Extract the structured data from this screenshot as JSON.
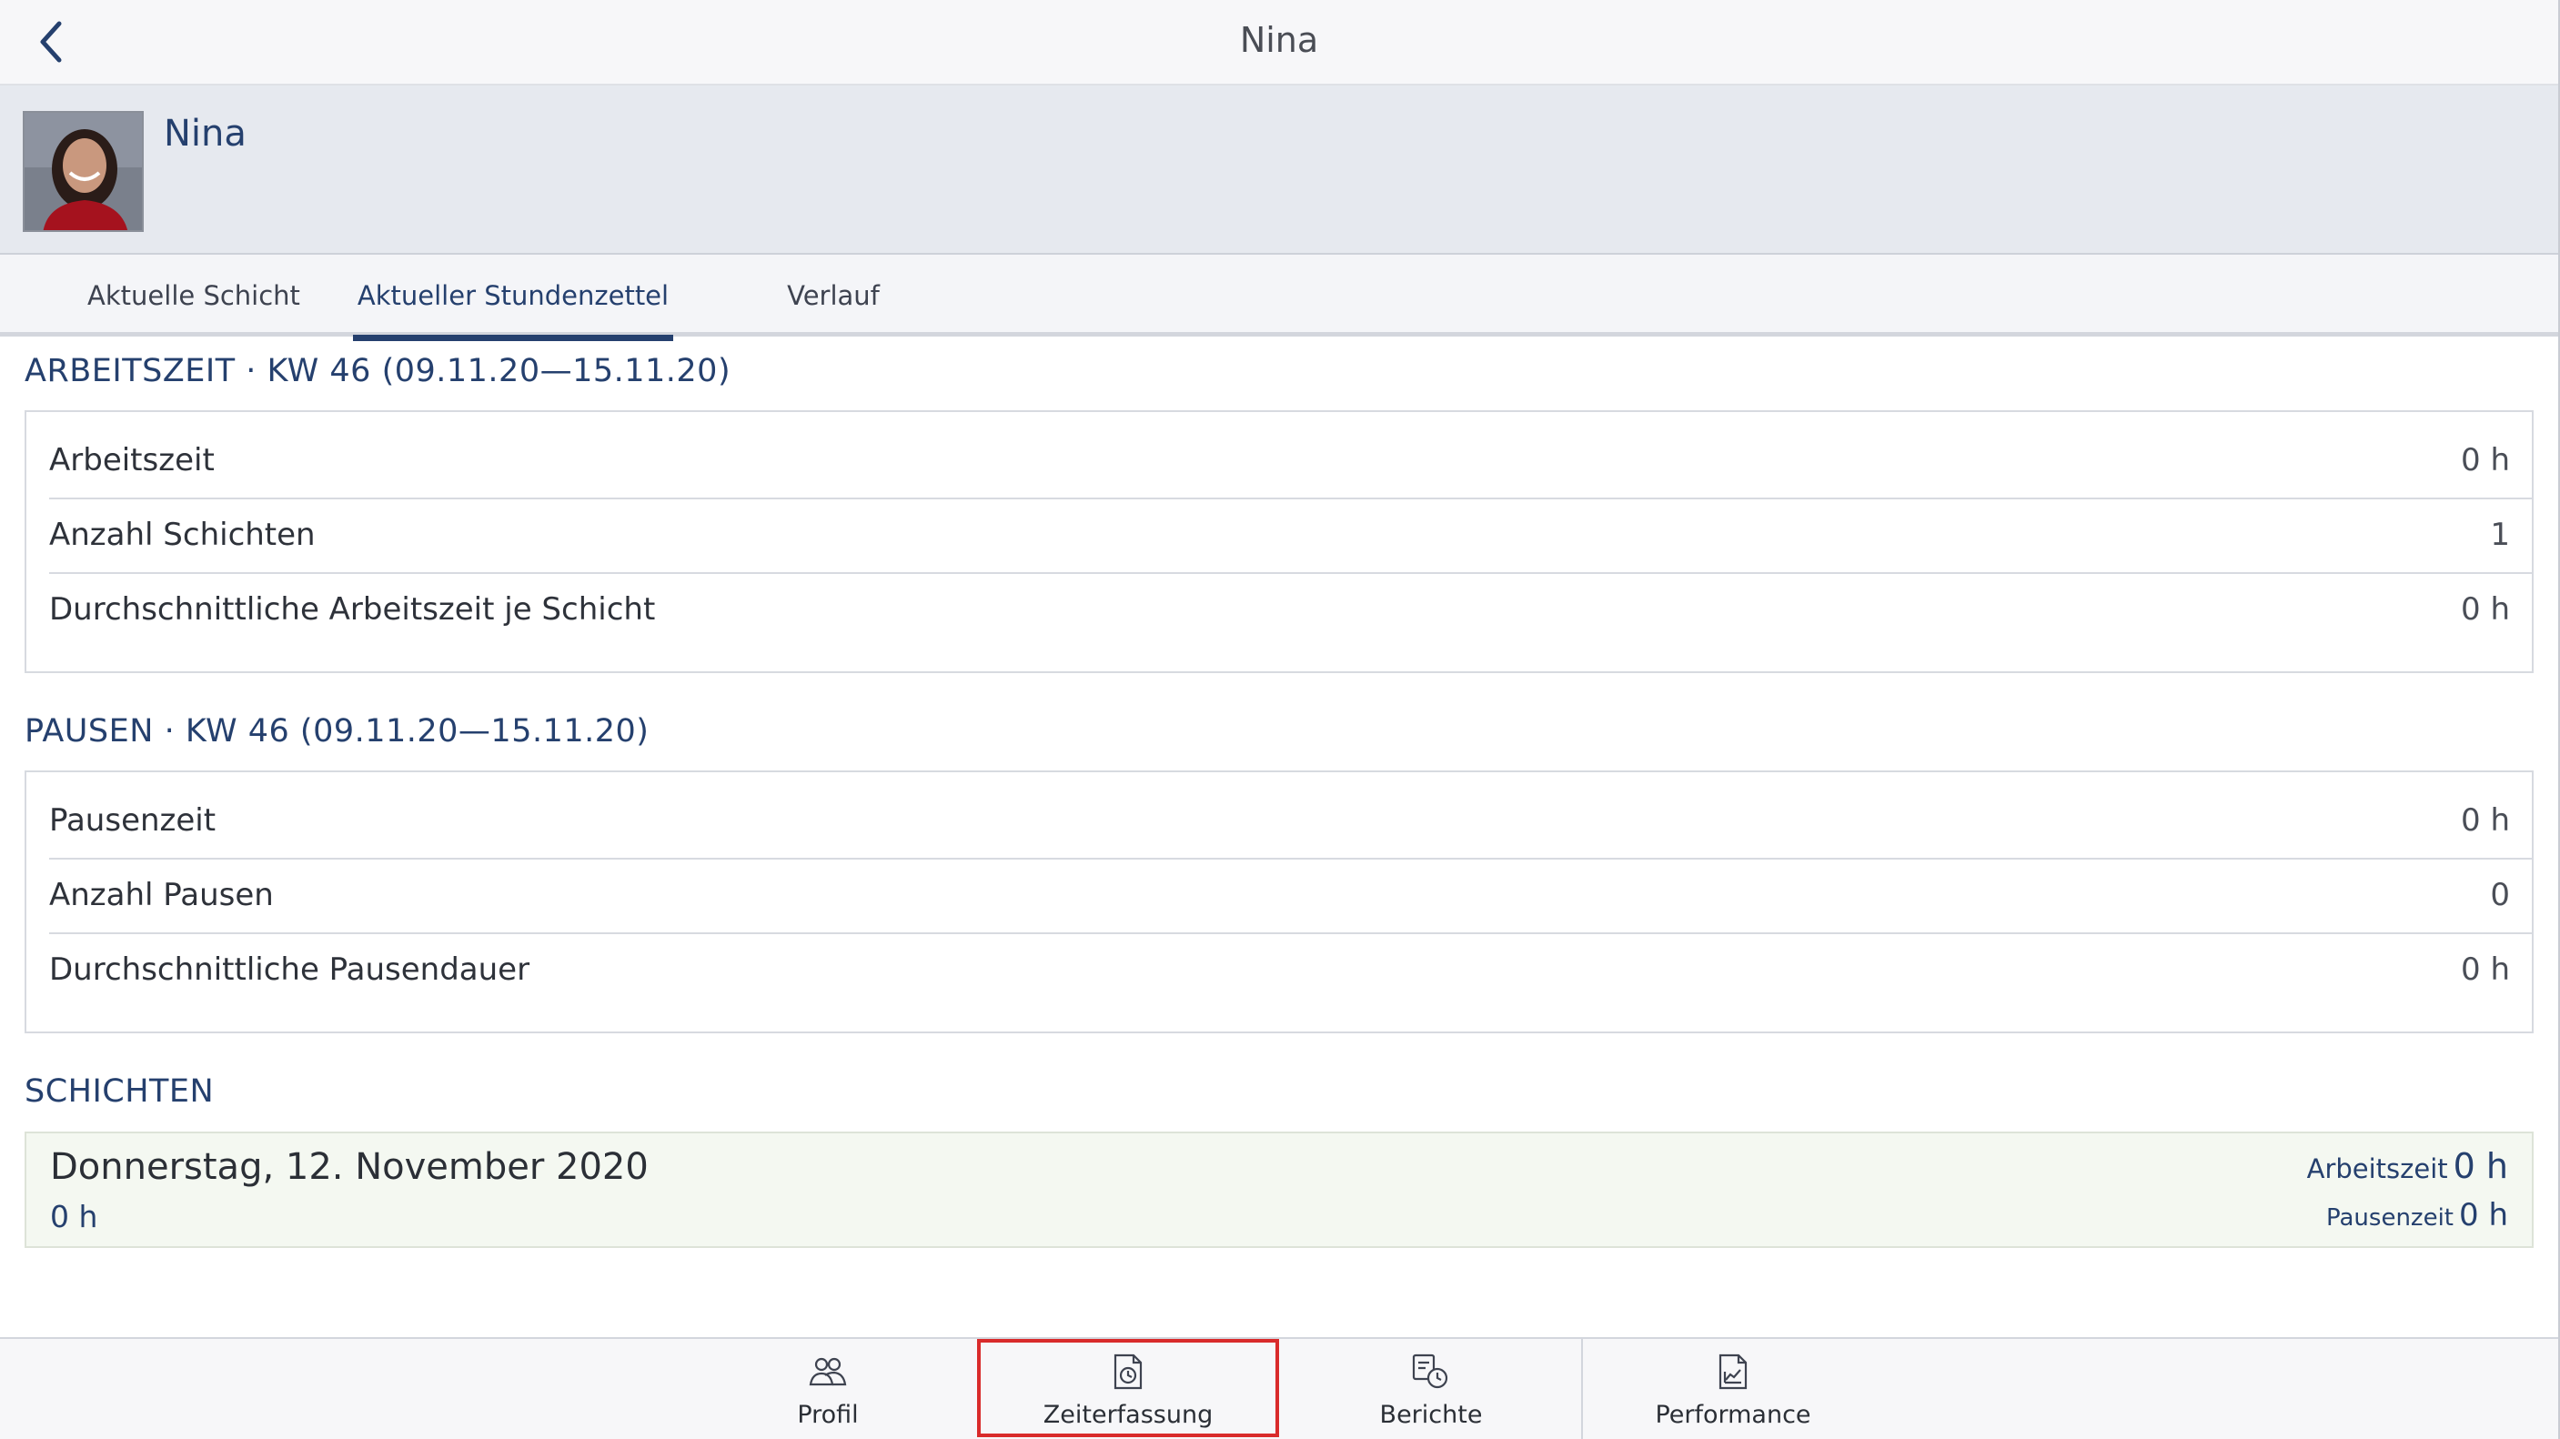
{
  "navbar": {
    "title": "Nina",
    "back_icon": "chevron-left-icon"
  },
  "profile": {
    "name": "Nina",
    "avatar": "avatar-photo"
  },
  "tabs": [
    {
      "label": "Aktuelle Schicht",
      "active": false
    },
    {
      "label": "Aktueller Stundenzettel",
      "active": true
    },
    {
      "label": "Verlauf",
      "active": false
    }
  ],
  "arbeitszeit": {
    "title": "ARBEITSZEIT · KW 46 (09.11.20—15.11.20)",
    "rows": [
      {
        "label": "Arbeitszeit",
        "value": "0 h"
      },
      {
        "label": "Anzahl Schichten",
        "value": "1"
      },
      {
        "label": "Durchschnittliche Arbeitszeit je Schicht",
        "value": "0 h"
      }
    ]
  },
  "pausen": {
    "title": "PAUSEN · KW 46 (09.11.20—15.11.20)",
    "rows": [
      {
        "label": "Pausenzeit",
        "value": "0 h"
      },
      {
        "label": "Anzahl Pausen",
        "value": "0"
      },
      {
        "label": "Durchschnittliche Pausendauer",
        "value": "0 h"
      }
    ]
  },
  "schichten": {
    "title": "SCHICHTEN",
    "items": [
      {
        "date": "Donnerstag, 12. November 2020",
        "hours": "0 h",
        "arbeitszeit_label": "Arbeitszeit",
        "arbeitszeit_value": "0 h",
        "pausenzeit_label": "Pausenzeit",
        "pausenzeit_value": "0 h"
      }
    ]
  },
  "tabbar": {
    "items": [
      {
        "label": "Profil",
        "icon": "people-icon"
      },
      {
        "label": "Zeiterfassung",
        "icon": "document-clock-icon",
        "highlighted": true
      },
      {
        "label": "Berichte",
        "icon": "reports-clock-icon"
      },
      {
        "label": "Performance",
        "icon": "chart-document-icon"
      }
    ]
  },
  "colors": {
    "accent": "#25406e",
    "highlight": "#d92b2b",
    "shift_bg": "#f4f8f1"
  }
}
